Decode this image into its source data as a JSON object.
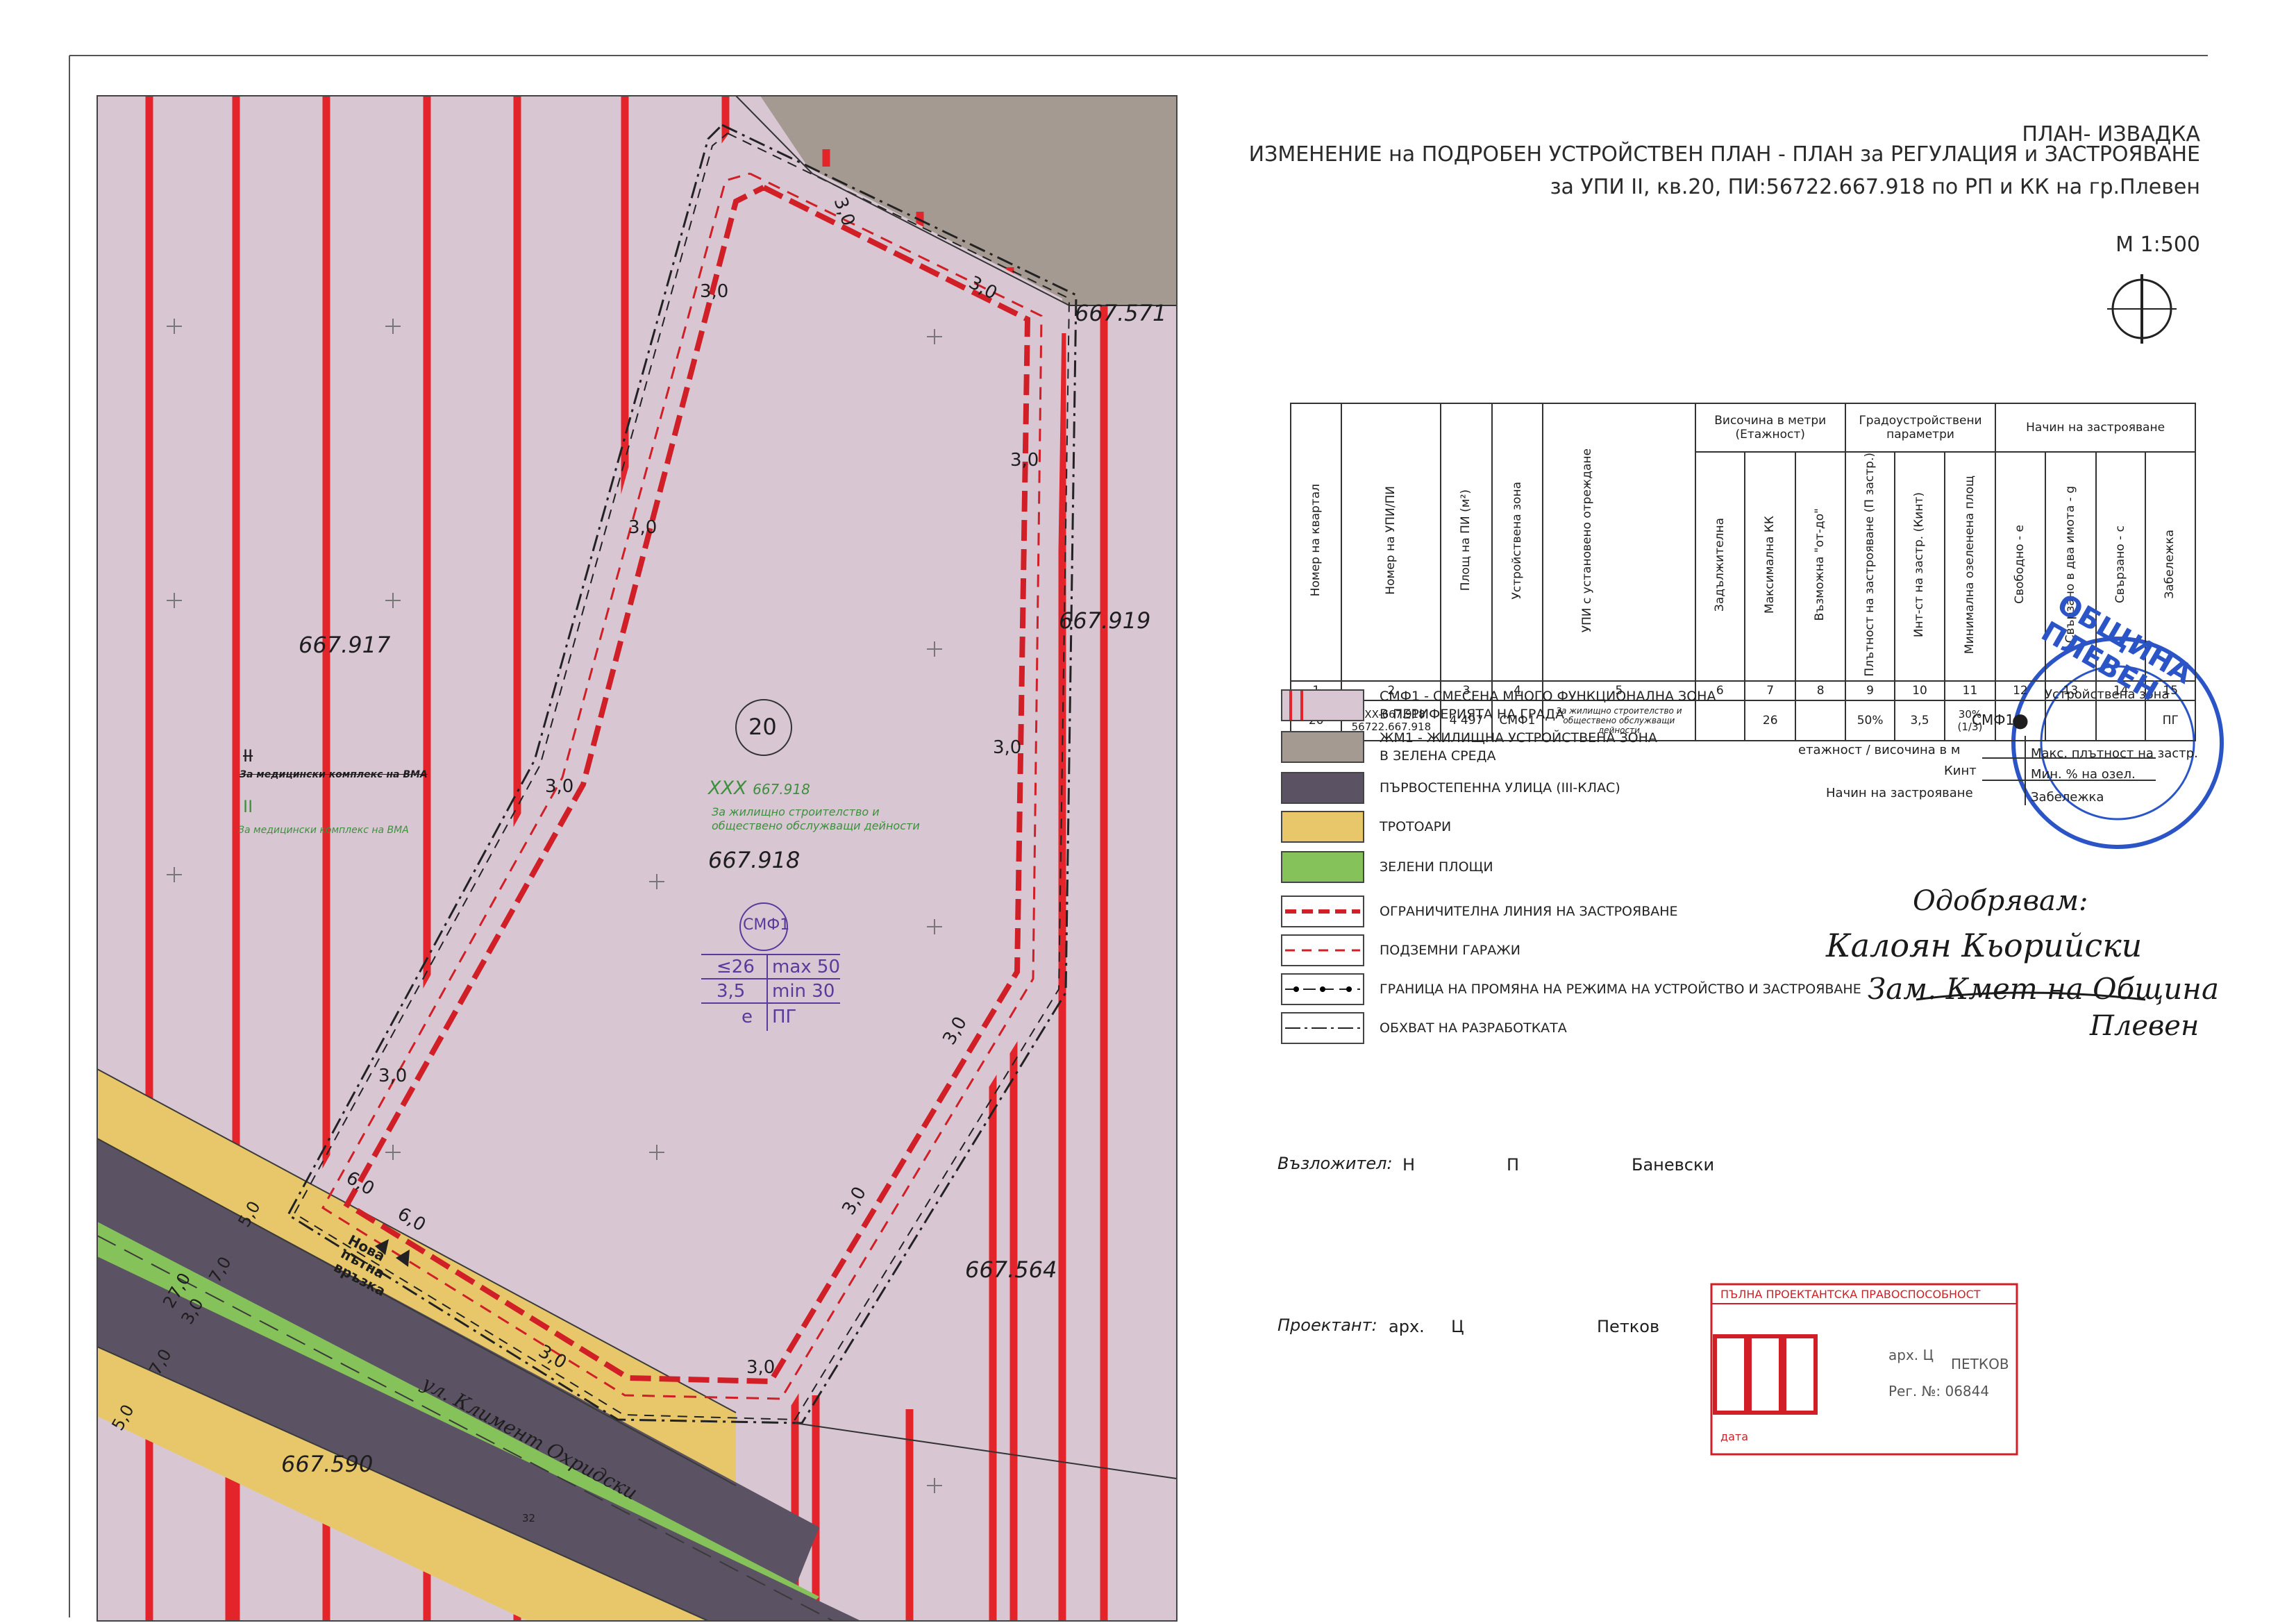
{
  "header": {
    "title": "ПЛАН- ИЗВАДКА",
    "line1": "ИЗМЕНЕНИЕ на ПОДРОБЕН УСТРОЙСТВЕН ПЛАН - ПЛАН за РЕГУЛАЦИЯ и ЗАСТРОЯВАНЕ",
    "line2": "за УПИ II, кв.20, ПИ:56722.667.918 по РП и КК на гр.Плевен",
    "scale": "М 1:500"
  },
  "map": {
    "parcels": [
      "667.571",
      "667.917",
      "667.919",
      "667.918",
      "667.564",
      "667.590"
    ],
    "quarter_no": "20",
    "upi_old_mark": "II",
    "upi_old_mark_strike": "II",
    "upi_old_text": "За медицински комплекс на ВМА",
    "upi_new_code": "XXX",
    "upi_new_parcel": "667.918",
    "upi_new_text_1": "За жилищно строителство и",
    "upi_new_text_2": "обществено обслужващи дейности",
    "zone_code": "СМФ1",
    "zone_cells": [
      "≤26",
      "max 50",
      "3,5",
      "min 30",
      "е",
      "ПГ"
    ],
    "offsets": [
      "3,0",
      "3,0",
      "3,0",
      "3,0",
      "3,0",
      "3,0",
      "3,0",
      "3,0",
      "3,0",
      "3,0",
      "3,0",
      "3,0",
      "6,0",
      "6,0"
    ],
    "road_widths": [
      "5,0",
      "7,0",
      "3,0",
      "7,0",
      "27,0",
      "5,0"
    ],
    "new_link": [
      "Нова",
      "пътна",
      "връзка"
    ],
    "street": "ул. Климент Охридски",
    "street_no": "32"
  },
  "table": {
    "group_headers": [
      "Височина в метри (Етажност)",
      "Градоустройствени параметри",
      "Начин на застрояване"
    ],
    "columns": [
      "Номер на квартал",
      "Номер на УПИ/ПИ",
      "Площ на ПИ (м²)",
      "Устройствена зона",
      "УПИ с установено отреждане",
      "Задължителна",
      "Максимална КК",
      "Възможна \"от-до\"",
      "Плътност на застрояване (П застр.)",
      "Инт-ст на застр. (Кинт)",
      "Минимална озеленена площ",
      "Свободно - е",
      "Свързано в два имота - g",
      "Свързано - с",
      "Забележка"
    ],
    "numbers": [
      "1",
      "2",
      "3",
      "4",
      "5",
      "6",
      "7",
      "8",
      "9",
      "10",
      "11",
      "12",
      "13",
      "14",
      "15"
    ],
    "row": [
      "20",
      "XXX-667.918\n56722.667.918",
      "4 497",
      "СМФ1",
      "За жилищно строителство и обществено обслужващи дейности",
      "",
      "26",
      "",
      "50%",
      "3,5",
      "30%\n(1/3)",
      "●",
      "",
      "",
      "ПГ"
    ]
  },
  "legend": [
    {
      "swatch": "smf",
      "text": "СМФ1 - СМЕСЕНА МНОГО ФУНКЦИОНАЛНА ЗОНА\nВ ПЕРИФЕРИЯТА НА ГРАДА"
    },
    {
      "swatch": "zhm",
      "text": "ЖМ1 - ЖИЛИЩНА УСТРОЙСТВЕНА ЗОНА\nВ ЗЕЛЕНА СРЕДА"
    },
    {
      "swatch": "street",
      "text": "ПЪРВОСТЕПЕННА УЛИЦА (III-КЛАС)"
    },
    {
      "swatch": "walk",
      "text": "ТРОТОАРИ"
    },
    {
      "swatch": "green",
      "text": "ЗЕЛЕНИ ПЛОЩИ"
    },
    {
      "swatch": "limit",
      "text": "ОГРАНИЧИТЕЛНА ЛИНИЯ НА ЗАСТРОЯВАНЕ"
    },
    {
      "swatch": "garage",
      "text": "ПОДЗЕМНИ ГАРАЖИ"
    },
    {
      "swatch": "change",
      "text": "ГРАНИЦА НА ПРОМЯНА НА РЕЖИМА НА УСТРОЙСТВО И ЗАСТРОЯВАНЕ"
    },
    {
      "swatch": "scope",
      "text": "ОБХВАТ НА РАЗРАБОТКАТА"
    }
  ],
  "key": {
    "zone": "СМФ1",
    "zone_label": "Устройствена зона",
    "row1_left": "етажност / височина в м",
    "row1_right": "Макс. плътност на застр.",
    "row2_left": "Кинт",
    "row2_right": "Мин. % на озел.",
    "row3_left": "Начин на застрояване",
    "row3_right": "Забележка"
  },
  "approval": {
    "l1": "Одобрявам:",
    "l2": "Калоян Кьорийски",
    "l3": "Зам. Кмет на Община",
    "l4": "Плевен"
  },
  "assignor": {
    "label": "Възложител:",
    "name1": "Н",
    "name2": "П",
    "name3": "Баневски"
  },
  "designer": {
    "label": "Проектант:",
    "prefix": "арх.",
    "name1": "Ц",
    "name2": "Петков"
  },
  "stamp": {
    "header": "ПЪЛНА ПРОЕКТАНТСКА ПРАВОСПОСОБНОСТ",
    "line1": "арх. Ц",
    "line2": "ПЕТКОВ",
    "reg": "Рег. №: 06844",
    "date": "дата"
  },
  "seal": {
    "text": "ОБЩИНА ПЛЕВЕН"
  },
  "colors": {
    "smf": "#d8c7d3",
    "zhm": "#a59a92",
    "street": "#5b5263",
    "walk": "#e8c76a",
    "green": "#86c25a",
    "red": "#e3242b",
    "dash_red": "#d01f27",
    "seal_blue": "#2b55c7"
  }
}
